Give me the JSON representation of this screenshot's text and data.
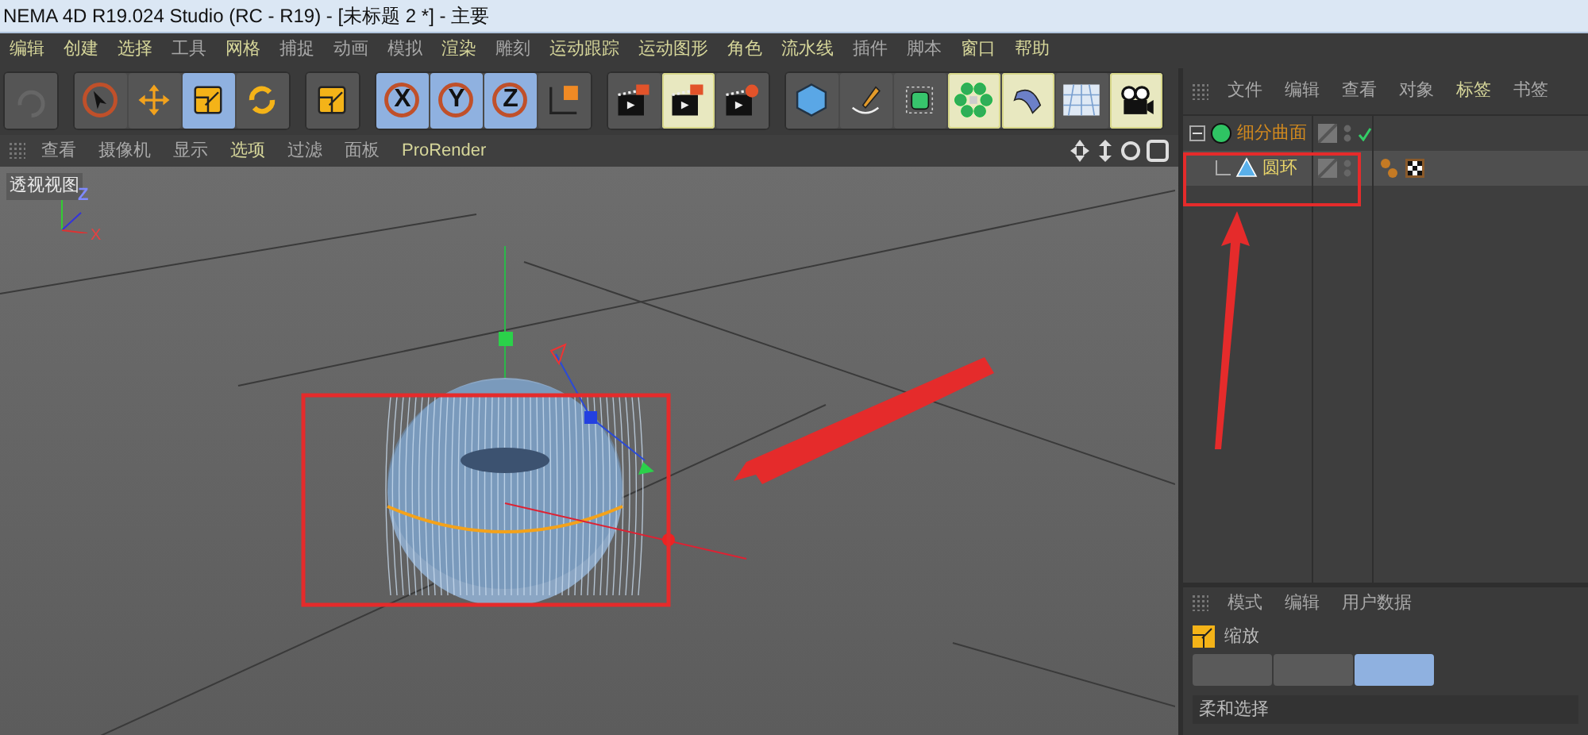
{
  "window": {
    "title": "NEMA 4D R19.024 Studio (RC - R19) - [未标题 2 *] - 主要"
  },
  "menu": [
    {
      "label": "编辑",
      "color": "#d6d69a"
    },
    {
      "label": "创建",
      "color": "#d6d69a"
    },
    {
      "label": "选择",
      "color": "#d6d69a"
    },
    {
      "label": "工具",
      "color": "#a8a8a8"
    },
    {
      "label": "网格",
      "color": "#d6d69a"
    },
    {
      "label": "捕捉",
      "color": "#a8a8a8"
    },
    {
      "label": "动画",
      "color": "#a8a8a8"
    },
    {
      "label": "模拟",
      "color": "#a8a8a8"
    },
    {
      "label": "渲染",
      "color": "#d6d69a"
    },
    {
      "label": "雕刻",
      "color": "#a8a8a8"
    },
    {
      "label": "运动跟踪",
      "color": "#d6d69a"
    },
    {
      "label": "运动图形",
      "color": "#d6d69a"
    },
    {
      "label": "角色",
      "color": "#d6d69a"
    },
    {
      "label": "流水线",
      "color": "#d6d69a"
    },
    {
      "label": "插件",
      "color": "#a8a8a8"
    },
    {
      "label": "脚本",
      "color": "#a8a8a8"
    },
    {
      "label": "窗口",
      "color": "#d6d69a"
    },
    {
      "label": "帮助",
      "color": "#d6d69a"
    }
  ],
  "toolbar": [
    {
      "kind": "undo",
      "selected": false
    },
    {
      "kind": "gap"
    },
    {
      "kind": "pointer",
      "selected": false
    },
    {
      "kind": "move",
      "selected": false
    },
    {
      "kind": "scale",
      "selected": true
    },
    {
      "kind": "rotate",
      "selected": false
    },
    {
      "kind": "gap"
    },
    {
      "kind": "scale",
      "selected": false
    },
    {
      "kind": "gap"
    },
    {
      "kind": "axis",
      "label": "X",
      "selected": true
    },
    {
      "kind": "axis",
      "label": "Y",
      "selected": true
    },
    {
      "kind": "axis",
      "label": "Z",
      "selected": true
    },
    {
      "kind": "coords",
      "selected": false
    },
    {
      "kind": "gap"
    },
    {
      "kind": "render",
      "selected": false
    },
    {
      "kind": "render",
      "selected": true
    },
    {
      "kind": "render-settings",
      "selected": false
    },
    {
      "kind": "gap"
    },
    {
      "kind": "cube",
      "selected": false
    },
    {
      "kind": "pen",
      "selected": false
    },
    {
      "kind": "subdiv",
      "selected": false
    },
    {
      "kind": "cloner",
      "selected": true
    },
    {
      "kind": "deformer",
      "selected": true
    },
    {
      "kind": "floor",
      "selected": false
    },
    {
      "kind": "camera",
      "selected": true
    }
  ],
  "viewport": {
    "menu": [
      {
        "label": "查看",
        "color": "#a8a8a8"
      },
      {
        "label": "摄像机",
        "color": "#a8a8a8"
      },
      {
        "label": "显示",
        "color": "#a8a8a8"
      },
      {
        "label": "选项",
        "color": "#d6d69a"
      },
      {
        "label": "过滤",
        "color": "#a8a8a8"
      },
      {
        "label": "面板",
        "color": "#a8a8a8"
      },
      {
        "label": "ProRender",
        "color": "#d6d69a"
      }
    ],
    "view_name": "透视视图",
    "axis_labels": [
      "Z",
      "X"
    ]
  },
  "object_manager": {
    "menu": [
      {
        "label": "文件",
        "color": "#a8a8a8"
      },
      {
        "label": "编辑",
        "color": "#a8a8a8"
      },
      {
        "label": "查看",
        "color": "#a8a8a8"
      },
      {
        "label": "对象",
        "color": "#a8a8a8"
      },
      {
        "label": "标签",
        "color": "#d6d69a"
      },
      {
        "label": "书签",
        "color": "#a8a8a8"
      }
    ],
    "objects": [
      {
        "name": "细分曲面",
        "kind": "subdiv",
        "selected": false,
        "expanded": true,
        "enabled": true,
        "children": [
          {
            "name": "圆环",
            "kind": "torus",
            "selected": true,
            "enabled": false,
            "tags": true
          }
        ]
      }
    ]
  },
  "attributes": {
    "menu": [
      {
        "label": "模式",
        "color": "#a8a8a8"
      },
      {
        "label": "编辑",
        "color": "#a8a8a8"
      },
      {
        "label": "用户数据",
        "color": "#a8a8a8"
      }
    ],
    "tool": "缩放",
    "buttons": [
      {
        "selected": false
      },
      {
        "selected": false
      },
      {
        "selected": true
      }
    ],
    "section": "柔和选择"
  }
}
